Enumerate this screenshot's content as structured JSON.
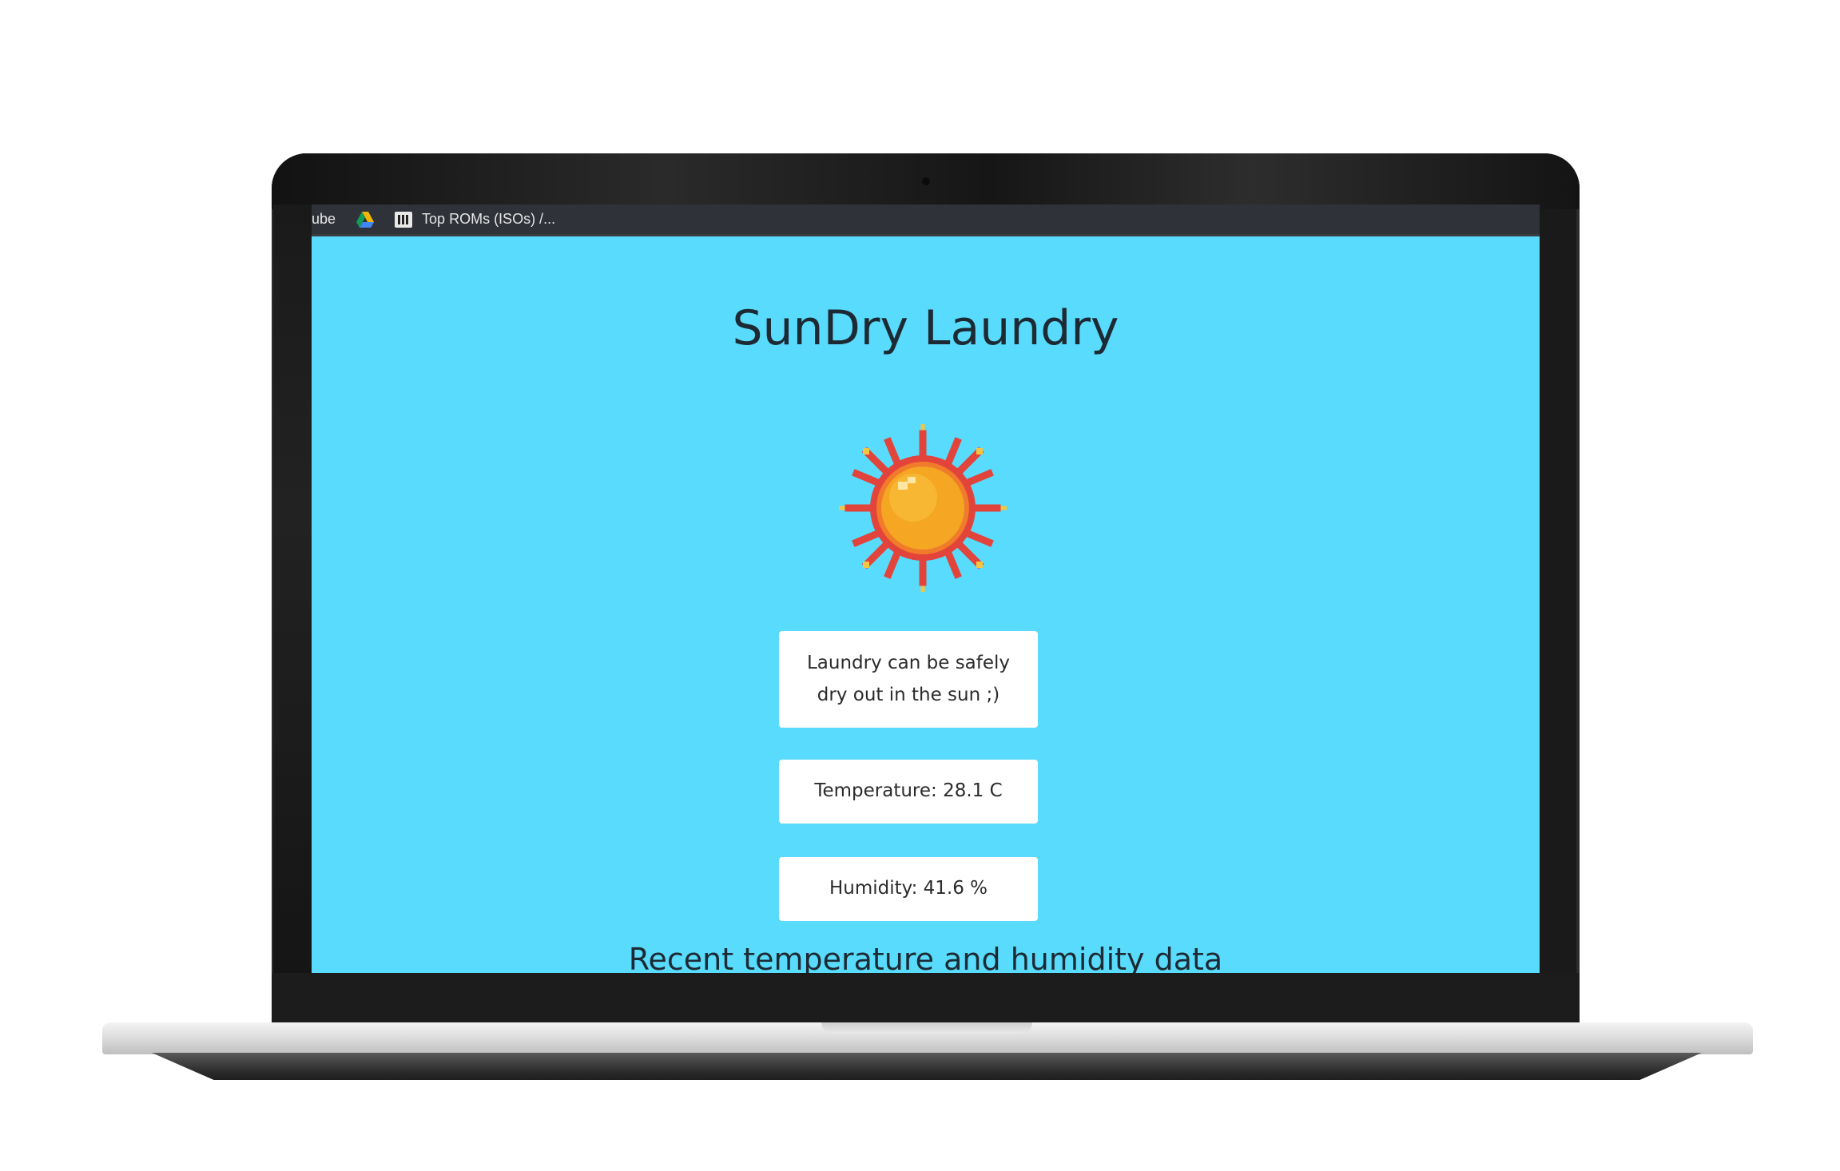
{
  "bookmarks": {
    "items": [
      {
        "label": "ube",
        "icon": "youtube-icon"
      },
      {
        "label": "",
        "icon": "google-drive-icon"
      },
      {
        "label": "Top ROMs (ISOs) /...",
        "icon": "roms-site-icon"
      }
    ]
  },
  "page": {
    "title": "SunDry Laundry",
    "weather_icon": "sun-icon",
    "status_message": "Laundry can be safely dry out in the sun ;)",
    "temperature": "Temperature: 28.1 C",
    "humidity": "Humidity: 41.6 %",
    "section_heading": "Recent temperature and humidity data"
  },
  "colors": {
    "page_background": "#58dbfc",
    "card_background": "#ffffff",
    "text": "#1e2a33",
    "bookmarks_bar": "#2f3238"
  }
}
